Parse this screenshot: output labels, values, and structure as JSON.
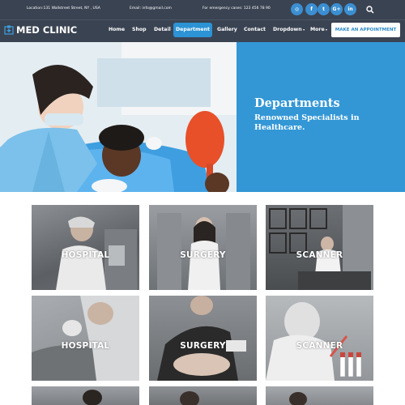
{
  "topbar": {
    "location": "Location:131 Wallstreet Street, NY , USA",
    "email": "Email: info@gmail.com",
    "emergency": "For emergency cases: 123 456 78 90",
    "social": [
      "rss-icon",
      "facebook-icon",
      "twitter-icon",
      "google-plus-icon",
      "linkedin-icon"
    ],
    "social_glyphs": [
      "◎",
      "f",
      "t",
      "G+",
      "in"
    ]
  },
  "header": {
    "logo_text": "MED CLINIC",
    "nav": [
      "Home",
      "Shop",
      "Detail",
      "Department",
      "Gallery",
      "Contact",
      "Dropdown",
      "More"
    ],
    "active": "Department",
    "cta": "MAKE AN APPOINTMENT"
  },
  "hero": {
    "title": "Departments",
    "subtitle": "Renowned Specialists in Healthcare."
  },
  "tiles": [
    {
      "label": "HOSPITAL"
    },
    {
      "label": "SURGERY"
    },
    {
      "label": "SCANNER"
    },
    {
      "label": "HOSPITAL"
    },
    {
      "label": "SURGERY"
    },
    {
      "label": "SCANNER"
    }
  ],
  "colors": {
    "accent": "#2c93d4",
    "dark": "#3a4352",
    "hero_blue": "#3397d6"
  }
}
